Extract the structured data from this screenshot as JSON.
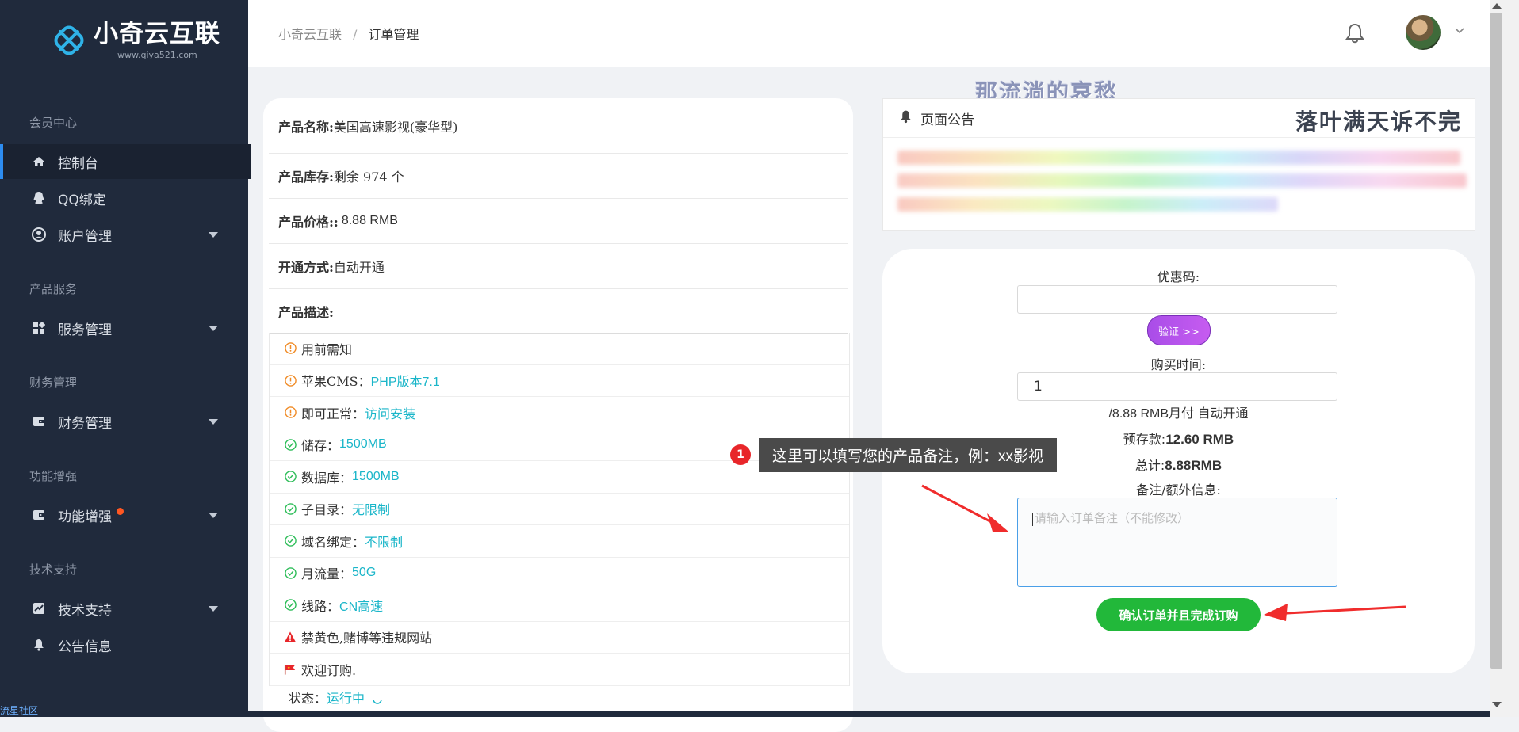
{
  "brand": {
    "name": "小奇云互联",
    "url": "www.qiya521.com",
    "accent": "#2d8cf0"
  },
  "sidebar": {
    "sections": [
      {
        "title": "会员中心"
      },
      {
        "title": "产品服务"
      },
      {
        "title": "财务管理"
      },
      {
        "title": "功能增强"
      },
      {
        "title": "技术支持"
      }
    ],
    "items": [
      {
        "label": "控制台",
        "icon": "home-icon"
      },
      {
        "label": "QQ绑定",
        "icon": "qq-icon"
      },
      {
        "label": "账户管理",
        "icon": "user-circle-icon"
      },
      {
        "label": "服务管理",
        "icon": "grid-icon"
      },
      {
        "label": "财务管理",
        "icon": "wallet-icon"
      },
      {
        "label": "功能增强",
        "icon": "wallet-icon"
      },
      {
        "label": "技术支持",
        "icon": "chart-icon"
      },
      {
        "label": "公告信息",
        "icon": "bell-icon"
      }
    ],
    "footer": "流星社区"
  },
  "header": {
    "breadcrumb": [
      "小奇云互联",
      "订单管理"
    ],
    "separator": "/"
  },
  "watermarks": [
    "那流淌的哀愁",
    "落叶满天诉不完"
  ],
  "product": {
    "name_label": "产品名称:",
    "name": "美国高速影视(豪华型)",
    "stock_label": "产品库存:",
    "stock": "剩余 974 个",
    "price_label": "产品价格::",
    "price": "8.88 RMB",
    "open_label": "开通方式:",
    "open": "自动开通",
    "desc_label": "产品描述:",
    "features": [
      {
        "icon": "info-circle-icon",
        "text": "用前需知",
        "value": ""
      },
      {
        "icon": "info-circle-icon",
        "text": "苹果CMS：",
        "value": "PHP版本7.1"
      },
      {
        "icon": "info-circle-icon",
        "text": "即可正常：",
        "value": "访问安装"
      },
      {
        "icon": "check-circle-icon",
        "text": "储存：",
        "value": "1500MB"
      },
      {
        "icon": "check-circle-icon",
        "text": "数据库：",
        "value": "1500MB"
      },
      {
        "icon": "check-circle-icon",
        "text": "子目录：",
        "value": "无限制"
      },
      {
        "icon": "check-circle-icon",
        "text": "域名绑定：",
        "value": "不限制"
      },
      {
        "icon": "check-circle-icon",
        "text": "月流量：",
        "value": "50G"
      },
      {
        "icon": "check-circle-icon",
        "text": "线路：",
        "value": "CN高速"
      },
      {
        "icon": "warning-icon",
        "text": "禁黄色,赌博等违规网站",
        "value": ""
      },
      {
        "icon": "flag-icon",
        "text": "欢迎订购.",
        "value": ""
      }
    ],
    "status_label": "状态：",
    "status": "运行中"
  },
  "notice": {
    "title": "页面公告"
  },
  "order": {
    "coupon_label": "优惠码:",
    "coupon_value": "",
    "verify_button": "验证 >>",
    "time_label": "购买时间:",
    "time_value": "1",
    "period_text": "/8.88 RMB月付 自动开通",
    "balance_label": "预存款:",
    "balance": "12.60 RMB",
    "total_label": "总计:",
    "total": "8.88RMB",
    "remark_label": "备注/额外信息:",
    "remark_placeholder": "请输入订单备注（不能修改）",
    "confirm_button": "确认订单并且完成订购"
  },
  "tooltip": {
    "number": "1",
    "text": "这里可以填写您的产品备注，例：xx影视"
  }
}
